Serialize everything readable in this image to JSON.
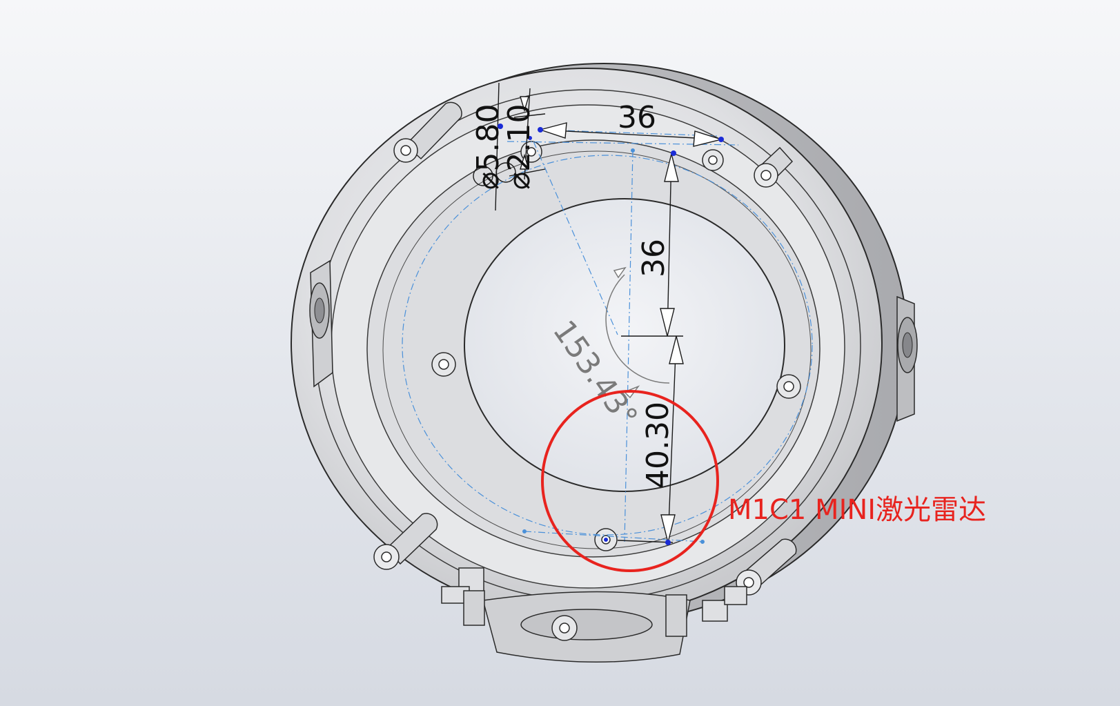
{
  "dimensions": {
    "diam_outer": "⌀5.80",
    "diam_inner": "⌀2.10",
    "horizontal_spacing": "36",
    "vertical_spacing": "36",
    "angle": "153.43°",
    "lower_offset": "40.30"
  },
  "annotation": {
    "label": "M1C1 MINI激光雷达",
    "color": "#e8231e"
  },
  "colors": {
    "model_fill": "#dcdde0",
    "model_edge": "#2a2a2a",
    "construction_line": "#4a90d9",
    "sketch_point": "#1a2bd6",
    "highlight_circle": "#e8231e"
  }
}
